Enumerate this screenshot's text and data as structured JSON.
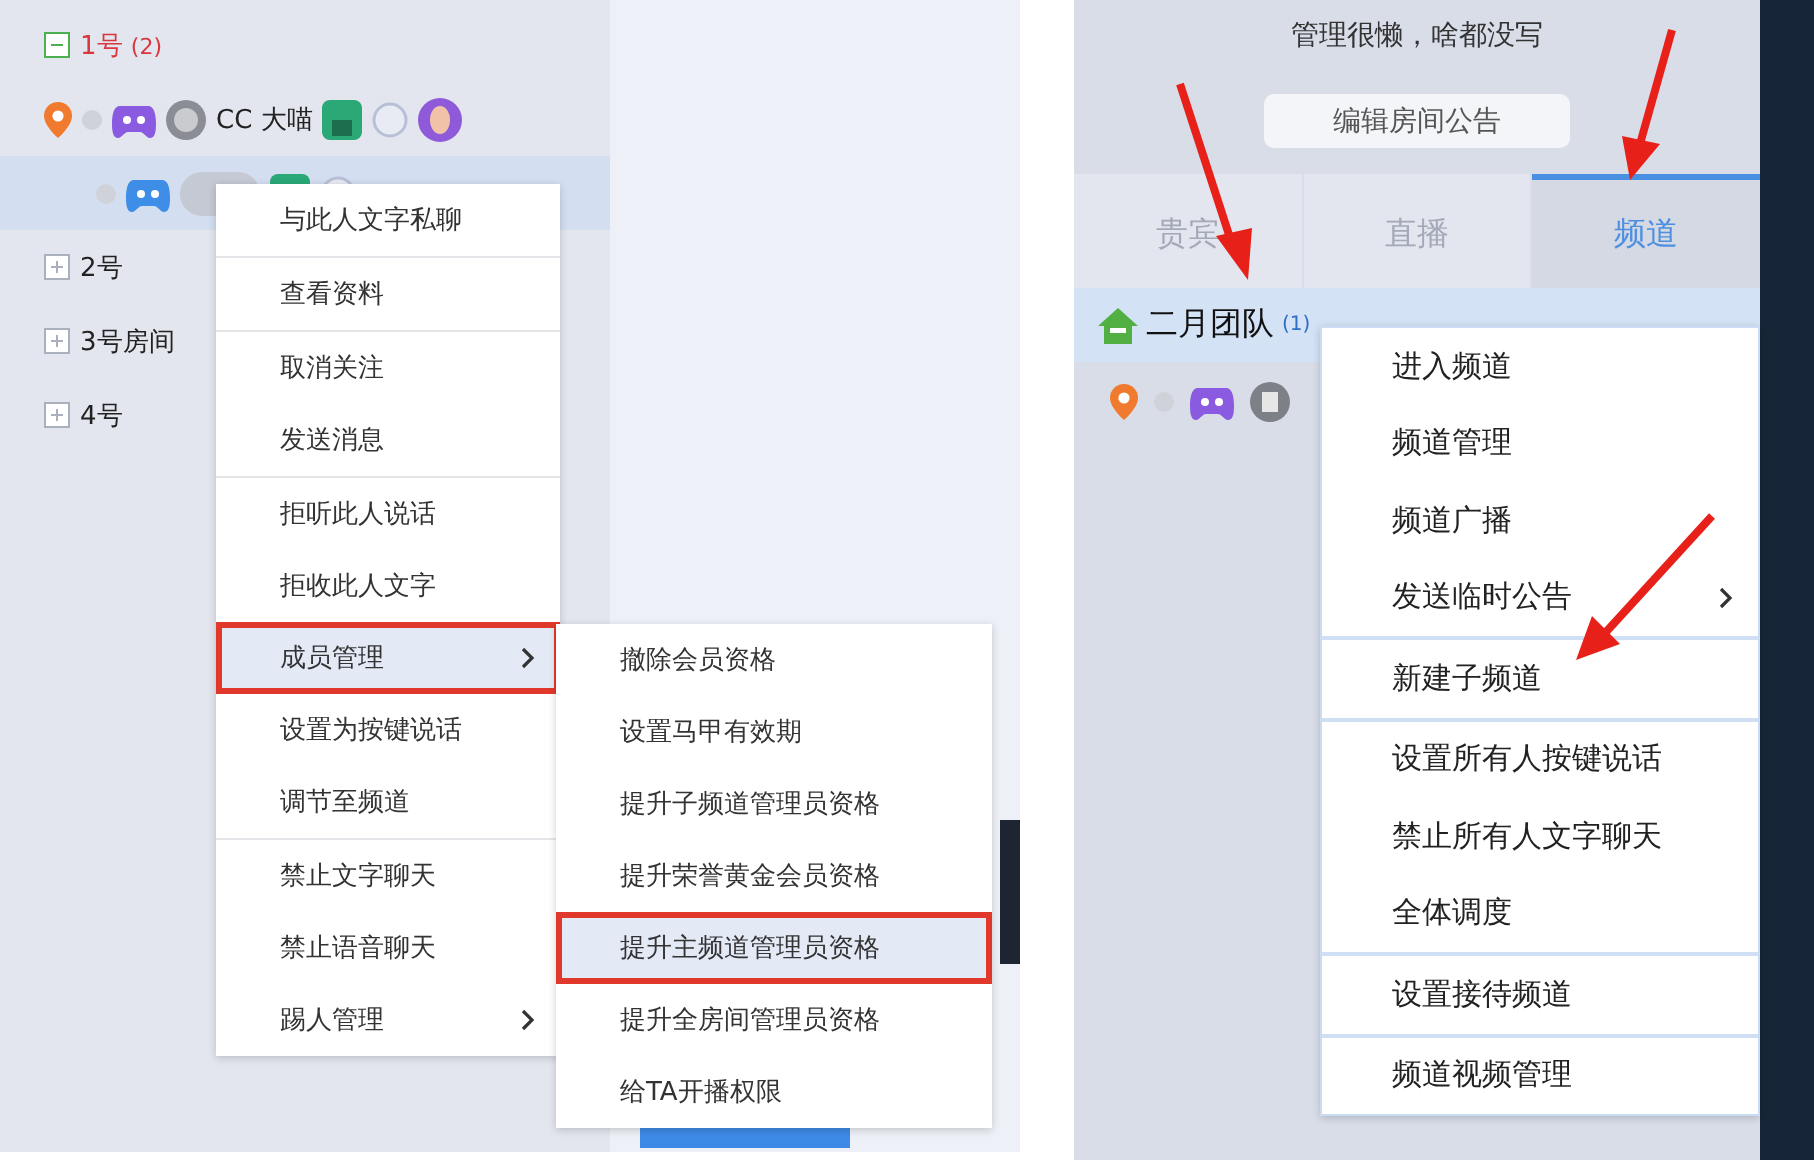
{
  "left_panel": {
    "tree": [
      {
        "kind": "group",
        "label": "1号",
        "count": "(2)",
        "expanded": true,
        "children": [
          {
            "kind": "user",
            "name": "CC 大喵",
            "selected": false
          },
          {
            "kind": "user",
            "selected": true
          }
        ]
      },
      {
        "kind": "group",
        "label": "2号",
        "expanded": false
      },
      {
        "kind": "group",
        "label": "3号房间",
        "expanded": false
      },
      {
        "kind": "group",
        "label": "4号",
        "expanded": false
      }
    ],
    "context_menu": {
      "groups": [
        [
          {
            "label": "与此人文字私聊",
            "submenu": false,
            "selected": false
          }
        ],
        [
          {
            "label": "查看资料",
            "submenu": false,
            "selected": false
          }
        ],
        [
          {
            "label": "取消关注",
            "submenu": false,
            "selected": false
          },
          {
            "label": "发送消息",
            "submenu": false,
            "selected": false
          }
        ],
        [
          {
            "label": "拒听此人说话",
            "submenu": false,
            "selected": false
          },
          {
            "label": "拒收此人文字",
            "submenu": false,
            "selected": false
          },
          {
            "label": "成员管理",
            "submenu": true,
            "selected": true
          },
          {
            "label": "设置为按键说话",
            "submenu": false,
            "selected": false
          },
          {
            "label": "调节至频道",
            "submenu": false,
            "selected": false
          }
        ],
        [
          {
            "label": "禁止文字聊天",
            "submenu": false,
            "selected": false
          },
          {
            "label": "禁止语音聊天",
            "submenu": false,
            "selected": false
          },
          {
            "label": "踢人管理",
            "submenu": true,
            "selected": false
          }
        ]
      ]
    },
    "submenu": {
      "items": [
        {
          "label": "撤除会员资格",
          "selected": false
        },
        {
          "label": "设置马甲有效期",
          "selected": false
        },
        {
          "label": "提升子频道管理员资格",
          "selected": false
        },
        {
          "label": "提升荣誉黄金会员资格",
          "selected": false
        },
        {
          "label": "提升主频道管理员资格",
          "selected": true
        },
        {
          "label": "提升全房间管理员资格",
          "selected": false
        },
        {
          "label": "给TA开播权限",
          "selected": false
        }
      ]
    }
  },
  "right_panel": {
    "notice": "管理很懒，啥都没写",
    "edit_button": "编辑房间公告",
    "tabs": [
      {
        "label": "贵宾",
        "selected": false
      },
      {
        "label": "直播",
        "selected": false
      },
      {
        "label": "频道",
        "selected": true
      }
    ],
    "channel": {
      "name": "二月团队",
      "count": "(1)",
      "selected": true
    },
    "context_menu": {
      "groups": [
        [
          {
            "label": "进入频道",
            "submenu": false,
            "selected": false
          },
          {
            "label": "频道管理",
            "submenu": false,
            "selected": false
          },
          {
            "label": "频道广播",
            "submenu": false,
            "selected": false
          },
          {
            "label": "发送临时公告",
            "submenu": true,
            "selected": false
          }
        ],
        [
          {
            "label": "新建子频道",
            "submenu": false,
            "selected": false
          }
        ],
        [
          {
            "label": "设置所有人按键说话",
            "submenu": false,
            "selected": false
          },
          {
            "label": "禁止所有人文字聊天",
            "submenu": false,
            "selected": false
          },
          {
            "label": "全体调度",
            "submenu": false,
            "selected": false
          }
        ],
        [
          {
            "label": "设置接待频道",
            "submenu": false,
            "selected": false
          }
        ],
        [
          {
            "label": "频道视频管理",
            "submenu": false,
            "selected": false
          }
        ]
      ]
    }
  }
}
